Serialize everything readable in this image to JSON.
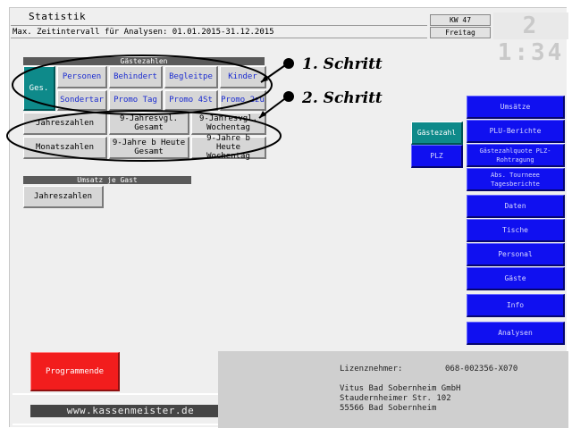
{
  "header": {
    "title": "Statistik",
    "subtitle": "Max. Zeitintervall für Analysen: 01.01.2015-31.12.2015",
    "week": "KW 47",
    "weekday": "Freitag",
    "clock": "2 1:34"
  },
  "gaestezahlen": {
    "section_label": "Gästezahlen",
    "ges_label": "Ges.",
    "row1": [
      "Personen",
      "Behindert",
      "Begleitpe",
      "Kinder"
    ],
    "row2": [
      "Sondertar",
      "Promo Tag",
      "Promo 4St",
      "Promo 2zu"
    ]
  },
  "zeitraum": {
    "jahreszahlen": "Jahreszahlen",
    "monatszahlen": "Monatszahlen",
    "jahresvgl_gesamt": [
      "9-Jahresvgl.",
      "Gesamt"
    ],
    "jahresvgl_wochentag": [
      "9-Jahresvgl.",
      "Wochentag"
    ],
    "jahre_heute_gesamt": [
      "9-Jahre b Heute",
      "Gesamt"
    ],
    "jahre_heute_wochentag": [
      "9-Jahre b Heute",
      "Wochentag"
    ]
  },
  "umsatz": {
    "section_label": "Umsatz je Gast",
    "jahreszahlen": "Jahreszahlen"
  },
  "annotations": {
    "step1": "1.  Schritt",
    "step2": "2.  Schritt"
  },
  "right_menu": {
    "gaestezahl": "Gästezahl",
    "plz": "PLZ",
    "items": [
      "Umsätze",
      "PLU-Berichte",
      "Gästezahlquote PLZ-Rohtragung",
      "Abs. Tourneee Tagesberichte",
      "Daten",
      "Tische",
      "Personal",
      "Gäste",
      "Info",
      "Analysen"
    ]
  },
  "footer": {
    "programmende": "Programmende",
    "website": "www.kassenmeister.de",
    "lizenz_label": "Lizenznehmer:",
    "lizenz_number": "068-002356-X070",
    "address_lines": [
      "Vitus Bad Sobernheim GmbH",
      "Staudernheimer Str. 102",
      "55566 Bad Sobernheim"
    ]
  },
  "colors": {
    "background": "#efefef",
    "button": "#d6d6d6",
    "teal": "#0e8a8a",
    "menu_blue": "#1010f0",
    "end_red": "#f21d1d",
    "section_bar": "#5a5a5a"
  }
}
